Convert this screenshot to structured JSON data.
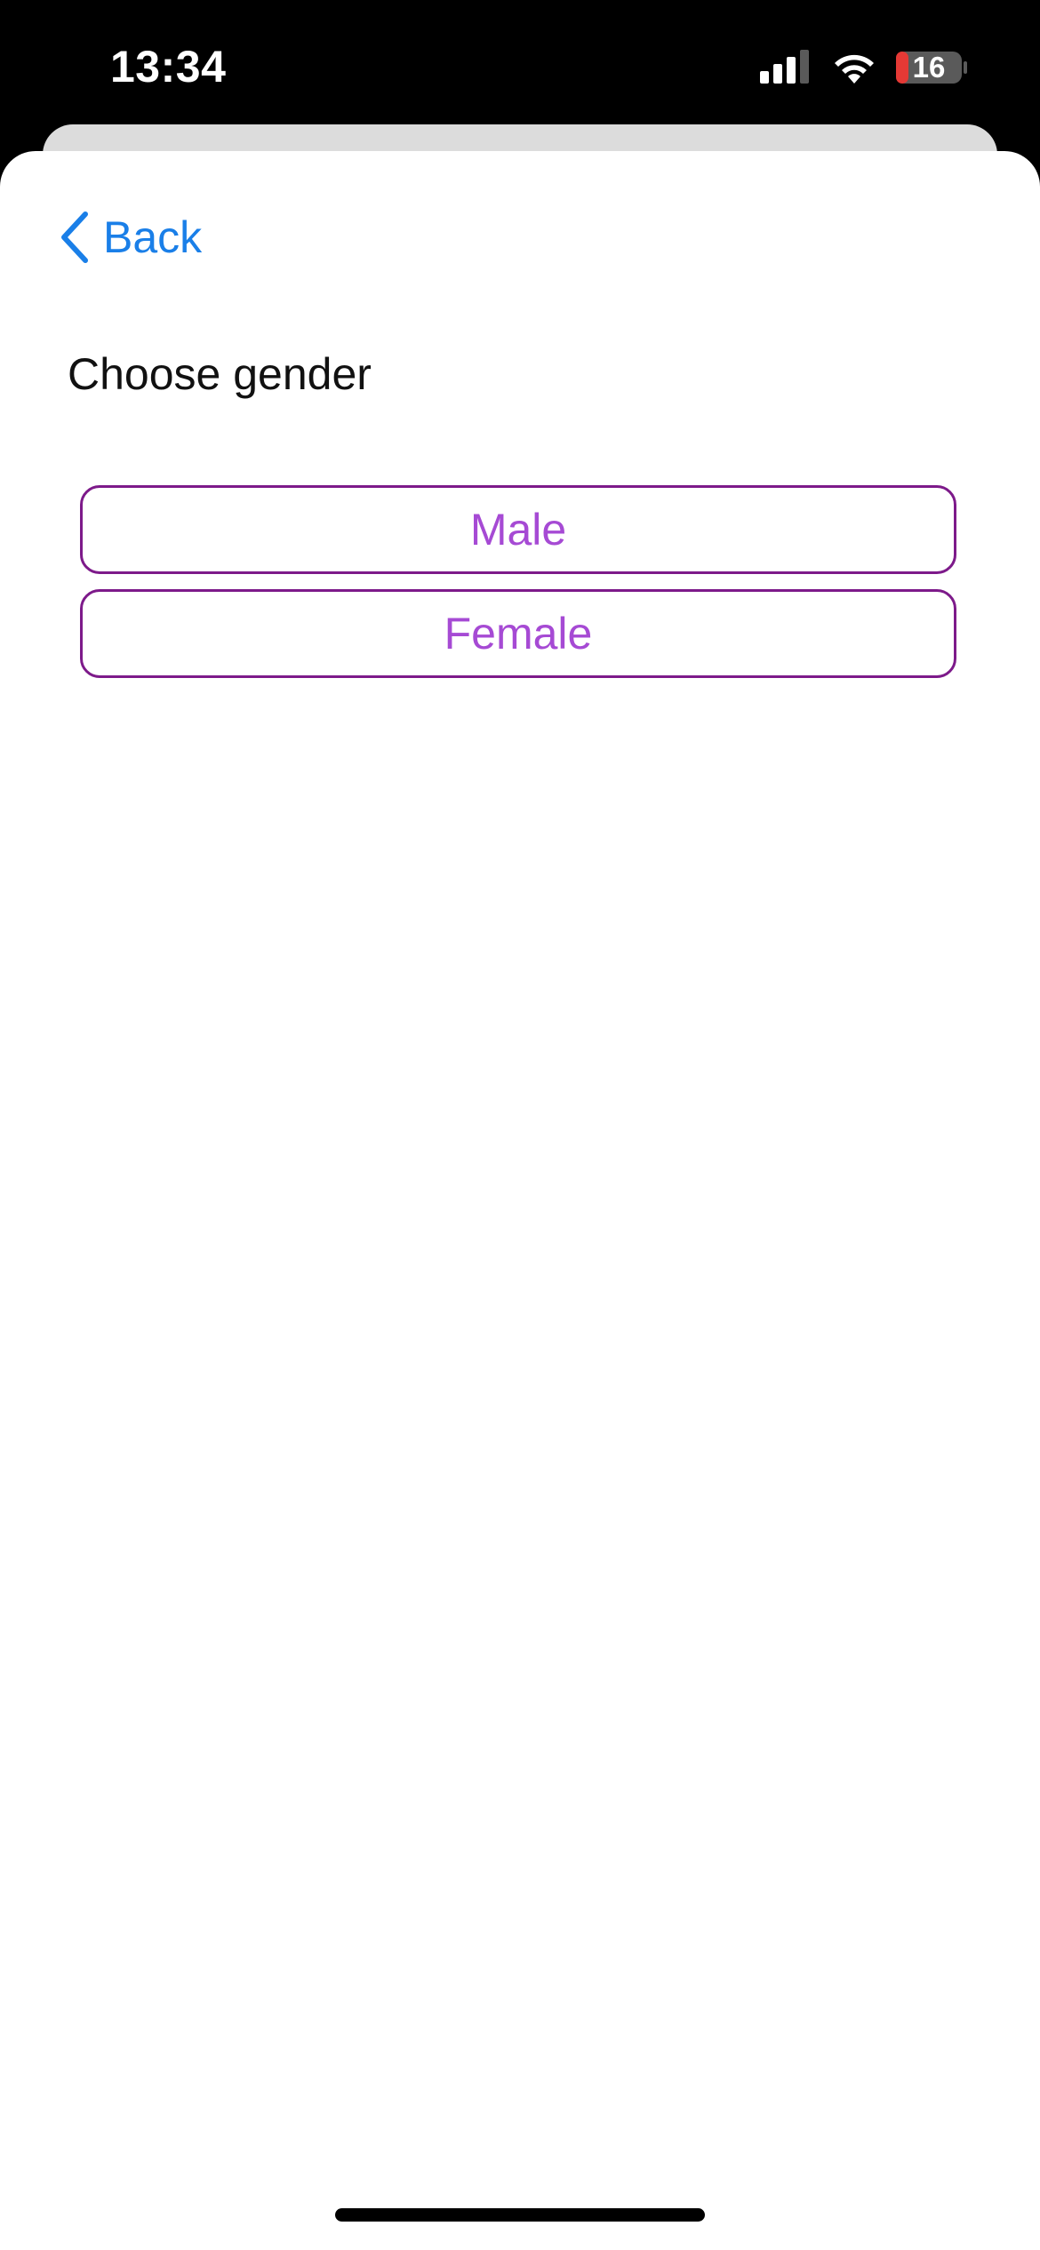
{
  "status_bar": {
    "time": "13:34",
    "battery_level": "16",
    "signal_icon": "cellular-signal-icon",
    "wifi_icon": "wifi-icon",
    "battery_icon": "battery-icon",
    "battery_color_low": "#e53935"
  },
  "navigation": {
    "back_label": "Back",
    "back_icon": "chevron-left-icon",
    "accent_color": "#1a7fe8"
  },
  "page": {
    "title": "Choose gender"
  },
  "options": [
    {
      "label": "Male"
    },
    {
      "label": "Female"
    }
  ],
  "colors": {
    "option_border": "#7d1a8a",
    "option_text": "#a64ad4"
  }
}
